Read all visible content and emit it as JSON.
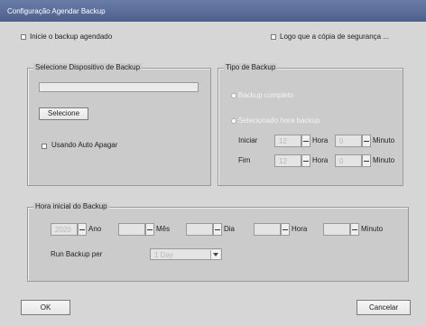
{
  "window": {
    "title": "Configuração Agendar Backup"
  },
  "top": {
    "check_backup": "Inicie o backup agendado",
    "check_logo": "Logo que a cópia de segurança ..."
  },
  "device": {
    "legend": "Selecione Dispositivo de Backup",
    "select_button": "Selecione",
    "auto_erase": "Usando Auto Apagar"
  },
  "type": {
    "legend": "Tipo de Backup",
    "full": "Backup completo",
    "selected": "Selecionado hora backup",
    "start": "Iniciar",
    "end": "Fim",
    "hour": "Hora",
    "minute": "Minuto",
    "start_hour": "12",
    "start_min": "0",
    "end_hour": "12",
    "end_min": "0"
  },
  "schedule": {
    "legend": "Hora inicial do Backup",
    "year_label": "Ano",
    "month_label": "Mês",
    "day_label": "Dia",
    "hour_label": "Hora",
    "minute_label": "Minuto",
    "year": "2020",
    "month": "",
    "day": "",
    "hour": "",
    "minute": "",
    "run_label": "Run Backup per",
    "run_value": "1 Day"
  },
  "buttons": {
    "ok": "OK",
    "cancel": "Cancelar"
  }
}
